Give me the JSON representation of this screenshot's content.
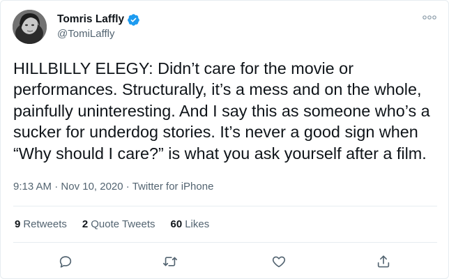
{
  "author": {
    "name": "Tomris Laffly",
    "handle": "@TomiLaffly",
    "verified": true
  },
  "tweet": {
    "lines": [
      "HILLBILLY ELEGY: Didn’t care for the movie or",
      "performances. Structurally, it’s a mess and on the whole,",
      "painfully uninteresting. And I say this as someone who’s a",
      "sucker for underdog stories. It’s never a good sign when",
      "“Why should I care?” is what you ask yourself after a film."
    ],
    "time": "9:13 AM",
    "separator": "·",
    "date": "Nov 10, 2020",
    "source": "Twitter for iPhone"
  },
  "stats": {
    "retweets_count": "9",
    "retweets_label": "Retweets",
    "quotes_count": "2",
    "quotes_label": "Quote Tweets",
    "likes_count": "60",
    "likes_label": "Likes"
  },
  "icons": {
    "more": "more-icon",
    "verified": "verified-badge-icon",
    "reply": "reply-icon",
    "retweet": "retweet-icon",
    "like": "heart-icon",
    "share": "share-icon"
  },
  "colors": {
    "text": "#0f1419",
    "secondary": "#536471",
    "accent": "#1d9bf0",
    "divider": "#e6ecf0"
  }
}
